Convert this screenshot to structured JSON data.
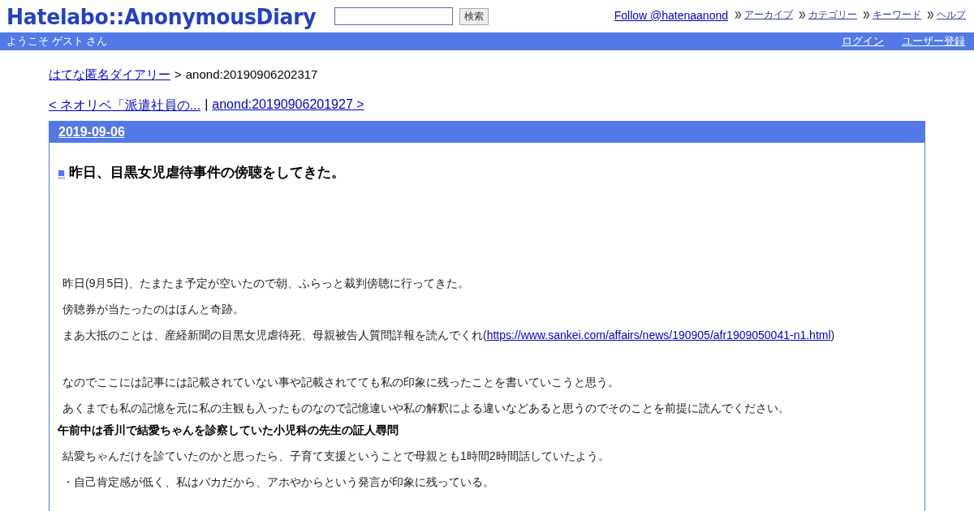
{
  "header": {
    "logo": "Hatelabo::AnonymousDiary",
    "search": {
      "button": "検索"
    },
    "follow": "Follow @hatenaanond",
    "nav": [
      "アーカイブ",
      "カテゴリー",
      "キーワード",
      "ヘルプ"
    ]
  },
  "userbar": {
    "welcome": "ようこそ ゲスト さん",
    "links": [
      "ログイン",
      "ユーザー登録"
    ]
  },
  "breadcrumb": {
    "link": "はてな匿名ダイアリー",
    "separator": ">",
    "current": "anond:20190906202317"
  },
  "pager": {
    "prev": "< ネオリベ「派遣社員の...",
    "separator": "|",
    "next": "anond:20190906201927 >"
  },
  "entry": {
    "date": "2019-09-06",
    "mark": "■",
    "title": "昨日、目黒女児虐待事件の傍聴をしてきた。",
    "body": [
      {
        "kind": "paragraph",
        "text": "昨日(9月5日)、たまたま予定が空いたので朝、ふらっと裁判傍聴に行ってきた。"
      },
      {
        "kind": "paragraph",
        "text": "傍聴券が当たったのはほんと奇跡。"
      },
      {
        "kind": "link_paragraph",
        "text": "まあ大抵のことは、産経新聞の目黒女児虐待死、母親被告人質問詳報を読んでくれ(",
        "link": "https://www.sankei.com/affairs/news/190905/afr1909050041-n1.html",
        "after": ")"
      },
      {
        "kind": "blank"
      },
      {
        "kind": "paragraph",
        "text": "なのでここには記事には記載されていない事や記載されてても私の印象に残ったことを書いていこうと思う。"
      },
      {
        "kind": "paragraph",
        "text": "あくまでも私の記憶を元に私の主観も入ったものなので記憶違いや私の解釈による違いなどあると思うのでそのことを前提に読んでください。"
      },
      {
        "kind": "heading",
        "text": "午前中は香川で結愛ちゃんを診察していた小児科の先生の証人尋問"
      },
      {
        "kind": "paragraph",
        "text": "結愛ちゃんだけを診ていたのかと思ったら、子育て支援ということで母親とも1時間2時間話していたよう。"
      },
      {
        "kind": "paragraph",
        "text": "・自己肯定感が低く、私はバカだから、アホやからという発言が印象に残っている。"
      }
    ]
  }
}
